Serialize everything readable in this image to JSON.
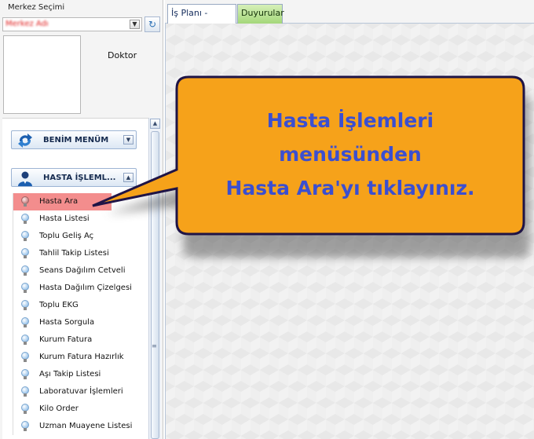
{
  "left_panel": {
    "center_label": "Merkez Seçimi",
    "center_value": "Merkez Adı",
    "role": "Doktor",
    "groups": [
      {
        "title": "BENİM MENÜM",
        "icon": "refresh-arrows-icon"
      },
      {
        "title": "HASTA İŞLEML...",
        "icon": "doctor-person-icon"
      }
    ],
    "items": [
      {
        "label": "Hasta Ara",
        "active": true
      },
      {
        "label": "Hasta Listesi"
      },
      {
        "label": "Toplu Geliş Aç"
      },
      {
        "label": "Tahlil Takip Listesi"
      },
      {
        "label": "Seans Dağılım Cetveli"
      },
      {
        "label": "Hasta Dağılım Çizelgesi"
      },
      {
        "label": "Toplu EKG"
      },
      {
        "label": "Hasta Sorgula"
      },
      {
        "label": "Kurum Fatura"
      },
      {
        "label": "Kurum Fatura Hazırlık"
      },
      {
        "label": "Aşı Takip Listesi"
      },
      {
        "label": "Laboratuvar İşlemleri"
      },
      {
        "label": "Kilo Order"
      },
      {
        "label": "Uzman Muayene Listesi"
      }
    ]
  },
  "tabs": [
    {
      "label": "İş Planı - Ajanda",
      "active": true
    },
    {
      "label": "Duyurular",
      "color": "#a4d77a"
    }
  ],
  "callout": {
    "lines": [
      "Hasta İşlemleri",
      "menüsünden",
      "Hasta Ara'yı tıklayınız."
    ],
    "fill": "#f6a21a",
    "border": "#1f1446",
    "text_color": "#3b4fd0"
  },
  "colors": {
    "active_item": "#f38d8d",
    "group_title": "#152a4e"
  }
}
